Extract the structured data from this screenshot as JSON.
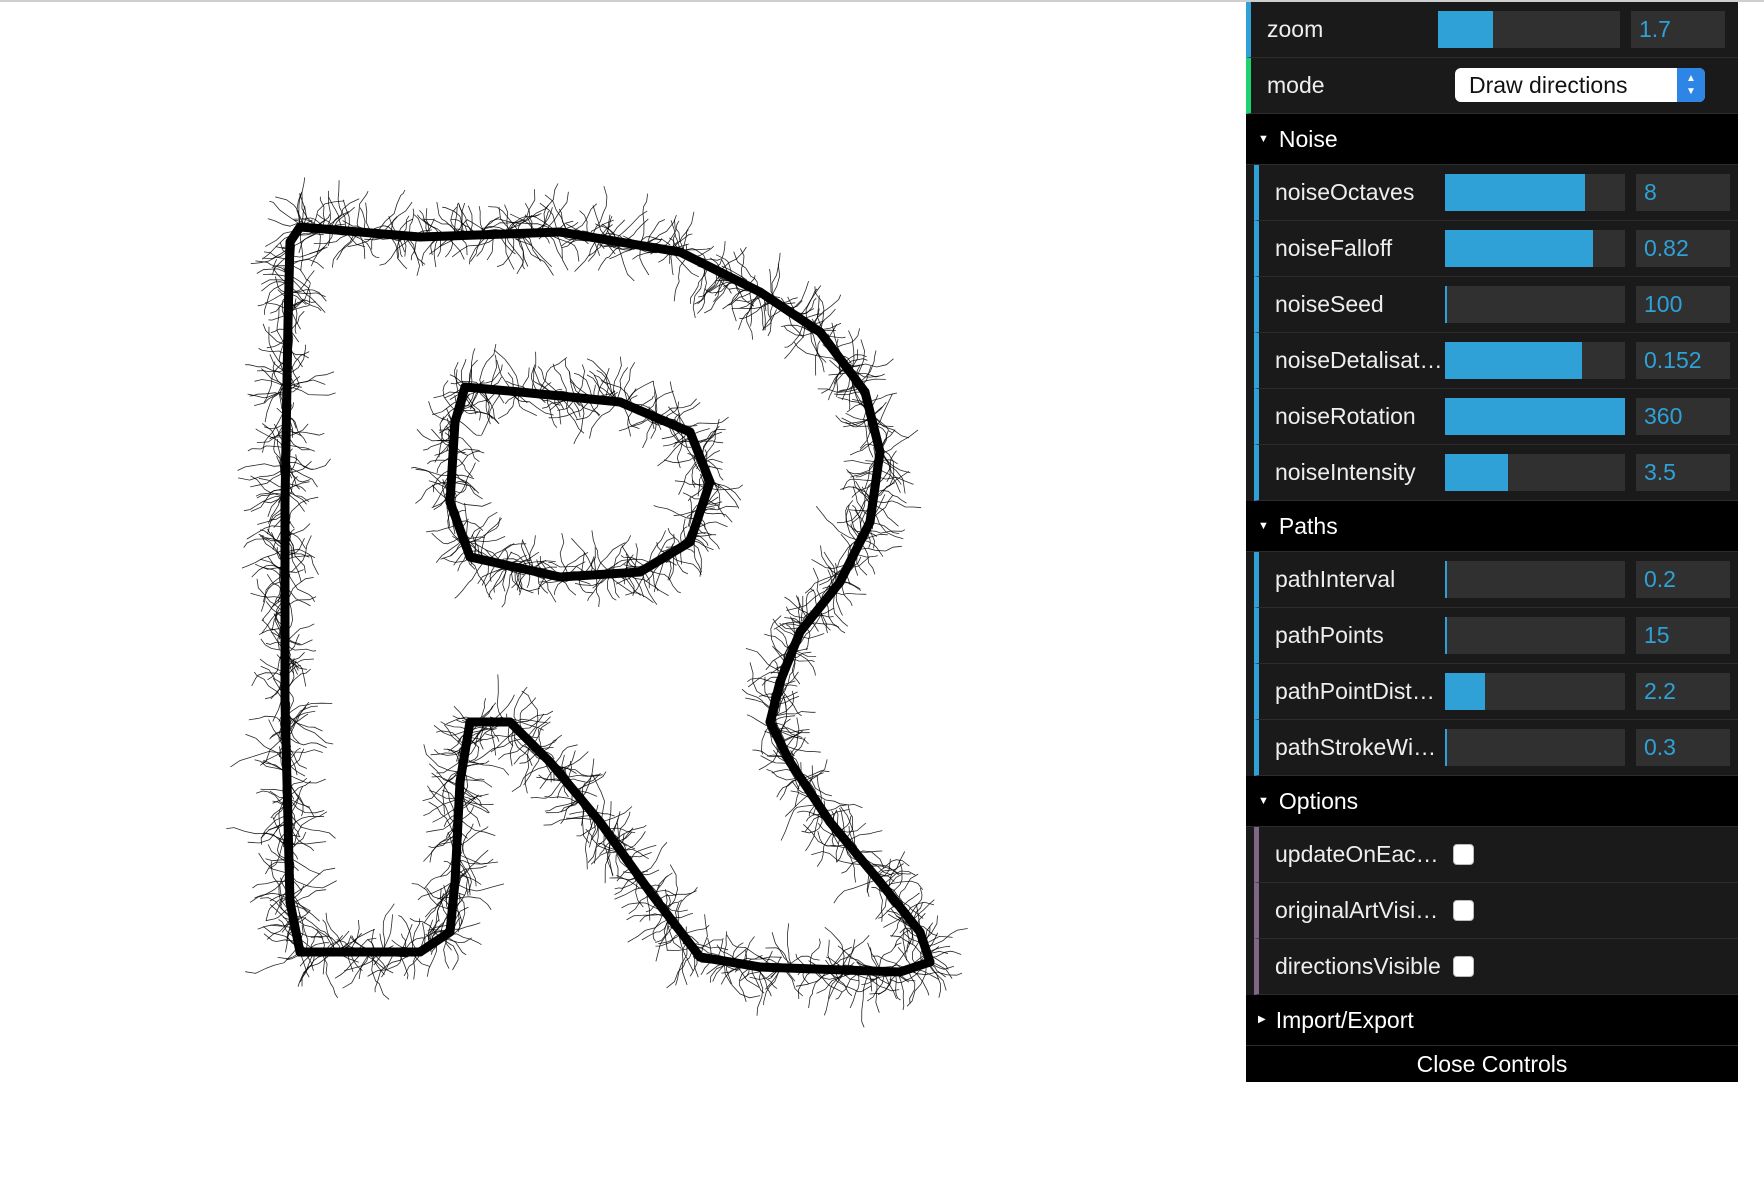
{
  "gui": {
    "top": [
      {
        "type": "number",
        "name": "zoom-control",
        "label": "zoom",
        "value": "1.7",
        "fill": 0.3
      },
      {
        "type": "select",
        "name": "mode-control",
        "label": "mode",
        "value": "Draw directions"
      }
    ],
    "folders": [
      {
        "name": "noise",
        "title": "Noise",
        "open": true,
        "rows": [
          {
            "type": "number",
            "label": "noiseOctaves",
            "value": "8",
            "fill": 0.78
          },
          {
            "type": "number",
            "label": "noiseFalloff",
            "value": "0.82",
            "fill": 0.82
          },
          {
            "type": "number",
            "label": "noiseSeed",
            "value": "100",
            "fill": 0.0
          },
          {
            "type": "number",
            "label": "noiseDetalisati…",
            "value": "0.152",
            "fill": 0.76
          },
          {
            "type": "number",
            "label": "noiseRotation",
            "value": "360",
            "fill": 1.0
          },
          {
            "type": "number",
            "label": "noiseIntensity",
            "value": "3.5",
            "fill": 0.35
          }
        ]
      },
      {
        "name": "paths",
        "title": "Paths",
        "open": true,
        "rows": [
          {
            "type": "number",
            "label": "pathInterval",
            "value": "0.2",
            "fill": 0.01
          },
          {
            "type": "number",
            "label": "pathPoints",
            "value": "15",
            "fill": 0.01
          },
          {
            "type": "number",
            "label": "pathPointDista…",
            "value": "2.2",
            "fill": 0.22
          },
          {
            "type": "number",
            "label": "pathStrokeWidth",
            "value": "0.3",
            "fill": 0.01
          }
        ]
      },
      {
        "name": "options",
        "title": "Options",
        "open": true,
        "rows": [
          {
            "type": "bool",
            "label": "updateOnEach…",
            "checked": false
          },
          {
            "type": "bool",
            "label": "originalArtVisib…",
            "checked": false
          },
          {
            "type": "bool",
            "label": "directionsVisible",
            "checked": false
          }
        ]
      },
      {
        "name": "import-export",
        "title": "Import/Export",
        "open": false,
        "rows": []
      }
    ],
    "close_label": "Close Controls"
  },
  "colors": {
    "accent": "#2fa1d6",
    "select_accent": "#1ed36f",
    "bool_accent": "#806787",
    "panel_bg": "#1a1a1a",
    "folder_bg": "#000000"
  },
  "canvas": {
    "art": "hairy-letter-R"
  }
}
